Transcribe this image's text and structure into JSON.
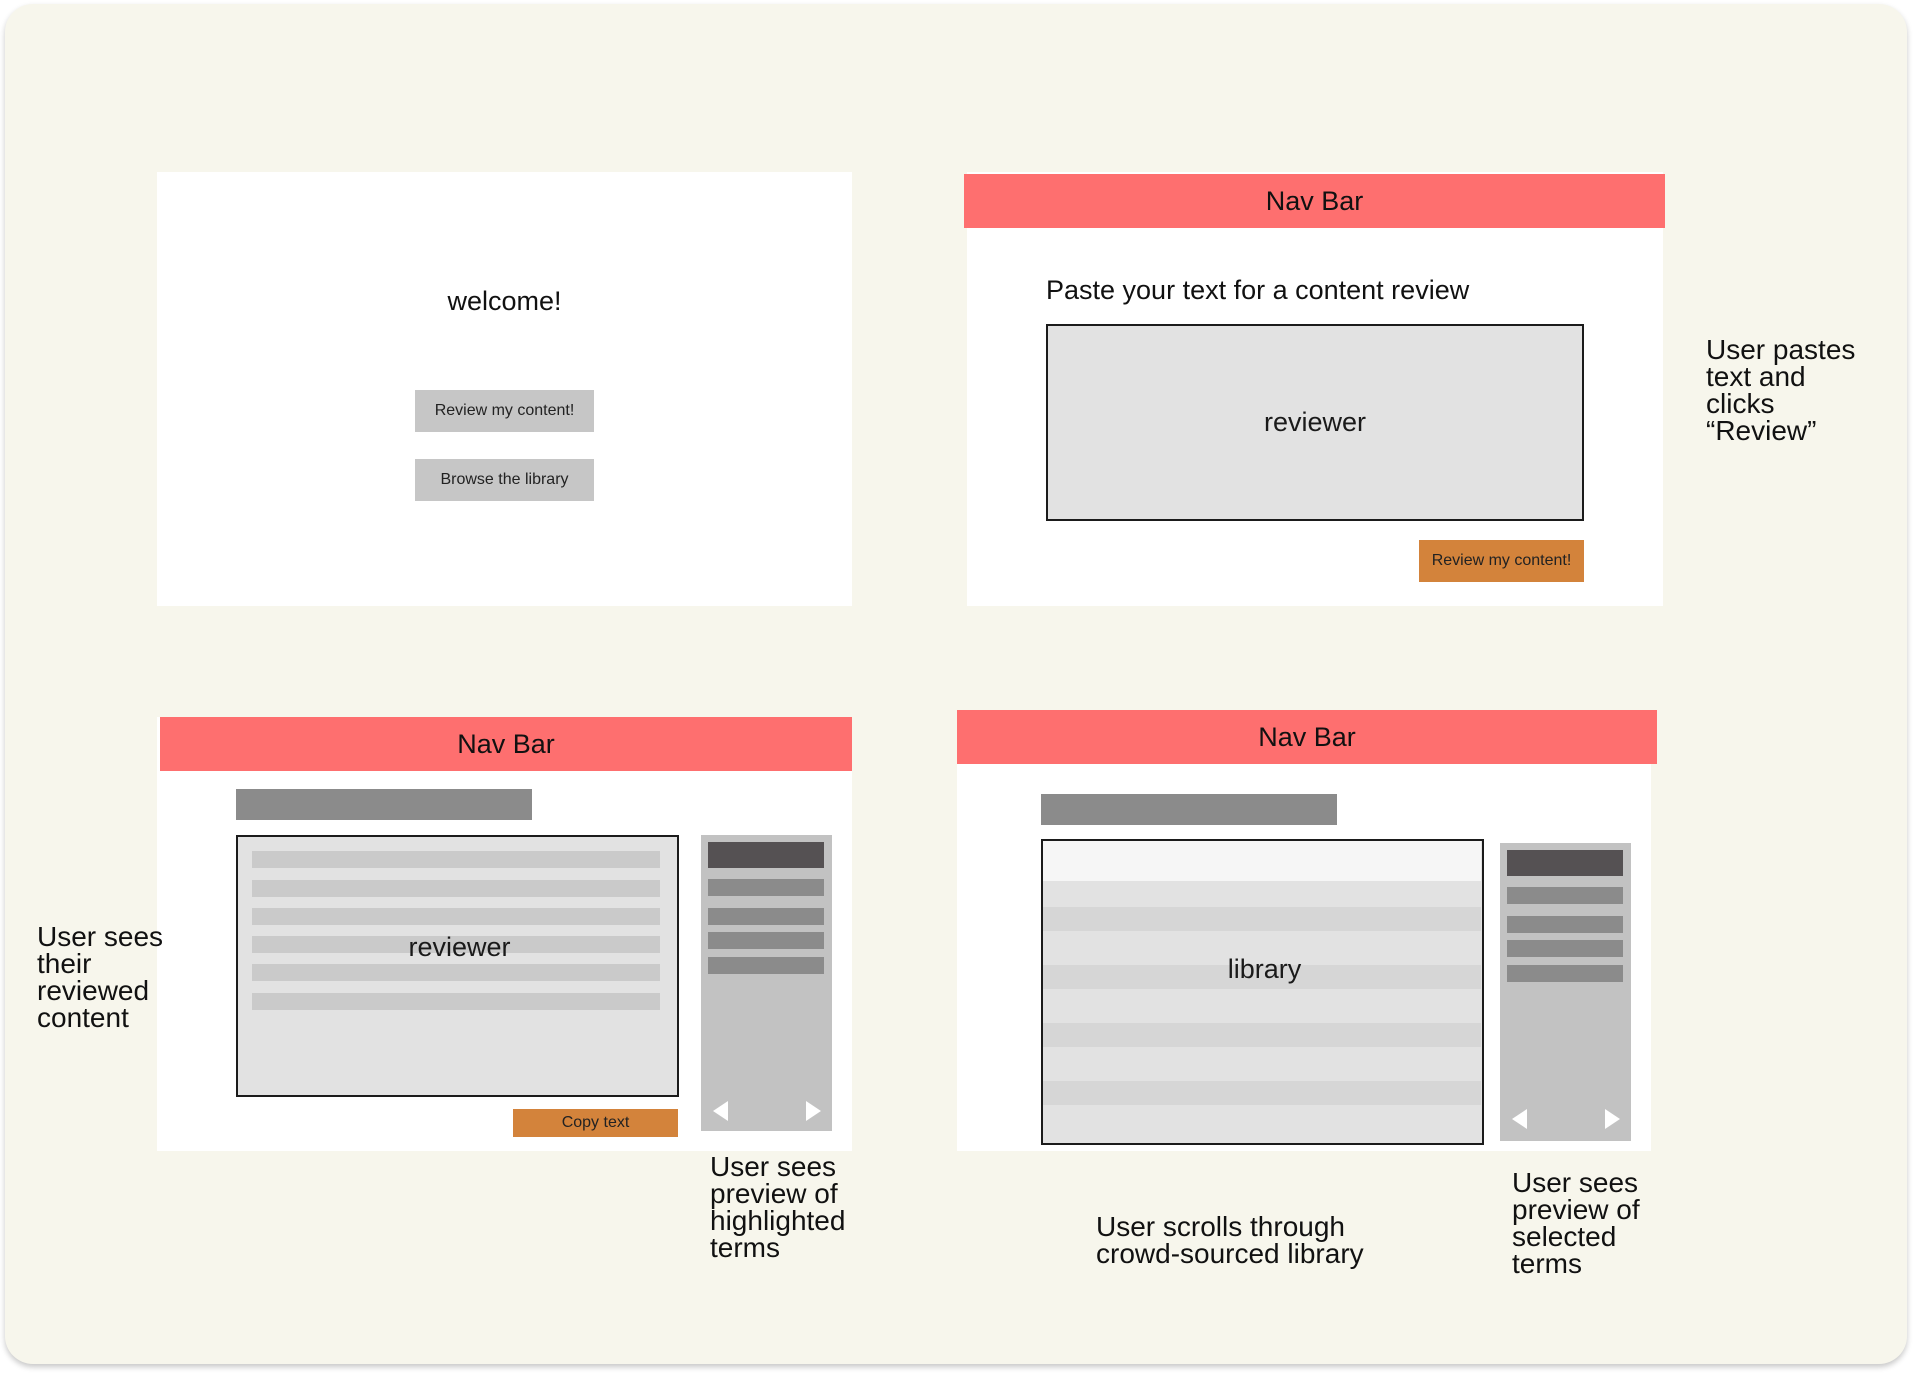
{
  "screens": {
    "welcome": {
      "title": "welcome!",
      "review_button": "Review my content!",
      "browse_button": "Browse the library"
    },
    "paste": {
      "navbar": "Nav Bar",
      "prompt": "Paste your text for a content review",
      "box_label": "reviewer",
      "review_button": "Review my content!"
    },
    "reviewed": {
      "navbar": "Nav Bar",
      "box_label": "reviewer",
      "copy_button": "Copy text"
    },
    "library": {
      "navbar": "Nav Bar",
      "box_label": "library"
    }
  },
  "notes": {
    "paste": "User pastes\ntext and\nclicks\n“Review”",
    "reviewed": "User sees\ntheir\nreviewed\ncontent",
    "highlighted": "User sees\npreview of\nhighlighted\nterms",
    "library": "User scrolls through\ncrowd-sourced library",
    "selected": "User sees\npreview of\nselected\nterms"
  },
  "colors": {
    "navbar": "#fe6f6f",
    "accent_button": "#d3833b",
    "board": "#f7f6ec"
  }
}
